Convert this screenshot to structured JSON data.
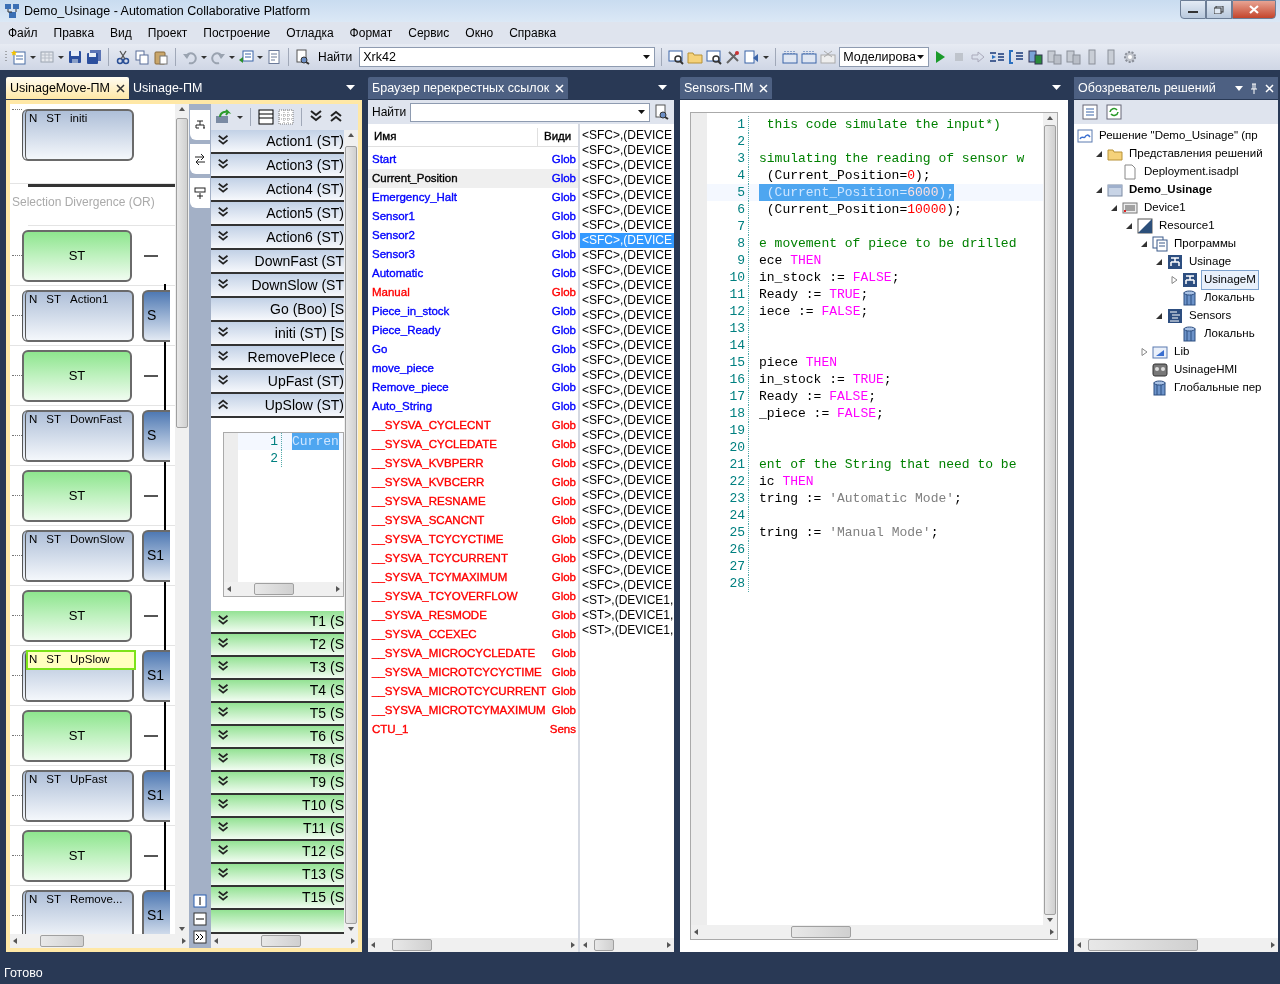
{
  "window": {
    "title": "Demo_Usinage - Automation Collaborative Platform"
  },
  "menu": [
    {
      "label": "Файл"
    },
    {
      "label": "Правка"
    },
    {
      "label": "Вид"
    },
    {
      "label": "Проект"
    },
    {
      "label": "Построение"
    },
    {
      "label": "Отладка"
    },
    {
      "label": "Формат"
    },
    {
      "label": "Сервис"
    },
    {
      "label": "Окно"
    },
    {
      "label": "Справка"
    }
  ],
  "toolbar": {
    "find_label": "Найти",
    "find_value": "Xrk42",
    "mode_value": "Моделирова"
  },
  "left_panel": {
    "tabs": [
      {
        "label": "UsinageMove-ПМ",
        "selected": true
      },
      {
        "label": "Usinage-ПМ",
        "selected": false
      }
    ],
    "sfc": [
      {
        "kind": "action",
        "qualifier": "N",
        "language": "ST",
        "name": "initi",
        "selected": false
      },
      {
        "kind": "divergence",
        "label": "Selection Divergence (OR)"
      },
      {
        "kind": "transition",
        "language": "ST"
      },
      {
        "kind": "action",
        "qualifier": "N",
        "language": "ST",
        "name": "Action1",
        "step": "S",
        "selected": false
      },
      {
        "kind": "transition",
        "language": "ST"
      },
      {
        "kind": "action",
        "qualifier": "N",
        "language": "ST",
        "name": "DownFast",
        "step": "S",
        "selected": false
      },
      {
        "kind": "transition",
        "language": "ST"
      },
      {
        "kind": "action",
        "qualifier": "N",
        "language": "ST",
        "name": "DownSlow",
        "step": "S1",
        "selected": false
      },
      {
        "kind": "transition",
        "language": "ST"
      },
      {
        "kind": "action",
        "qualifier": "N",
        "language": "ST",
        "name": "UpSlow",
        "step": "S1",
        "selected": true
      },
      {
        "kind": "transition",
        "language": "ST"
      },
      {
        "kind": "action",
        "qualifier": "N",
        "language": "ST",
        "name": "UpFast",
        "step": "S1",
        "selected": false
      },
      {
        "kind": "transition",
        "language": "ST"
      },
      {
        "kind": "action",
        "qualifier": "N",
        "language": "ST",
        "name": "Remove...",
        "step": "S1",
        "selected": false
      }
    ],
    "actions": [
      {
        "label": "Action1 (ST)",
        "kind": "code",
        "expanded": false
      },
      {
        "label": "Action3 (ST)",
        "kind": "code",
        "expanded": false
      },
      {
        "label": "Action4 (ST)",
        "kind": "code",
        "expanded": false
      },
      {
        "label": "Action5 (ST)",
        "kind": "code",
        "expanded": false
      },
      {
        "label": "Action6 (ST)",
        "kind": "code",
        "expanded": false
      },
      {
        "label": "DownFast (ST",
        "kind": "code",
        "expanded": false
      },
      {
        "label": "DownSlow (ST",
        "kind": "code",
        "expanded": false
      },
      {
        "label": "Go (Boo) [S",
        "kind": "boolean"
      },
      {
        "label": "initi (ST) [S",
        "kind": "code",
        "expanded": false
      },
      {
        "label": "RemovePIece (",
        "kind": "code",
        "expanded": false
      },
      {
        "label": "UpFast (ST)",
        "kind": "code",
        "expanded": false
      },
      {
        "label": "UpSlow (ST)",
        "kind": "code",
        "expanded": true
      }
    ],
    "action_code": [
      {
        "number": "1",
        "text": "Curren",
        "selected": true
      },
      {
        "number": "2"
      }
    ],
    "transitions": [
      {
        "label": "T1 (S"
      },
      {
        "label": "T2 (S"
      },
      {
        "label": "T3 (S"
      },
      {
        "label": "T4 (S"
      },
      {
        "label": "T5 (S"
      },
      {
        "label": "T6 (S"
      },
      {
        "label": "T8 (S"
      },
      {
        "label": "T9 (S"
      },
      {
        "label": "T10 (S"
      },
      {
        "label": "T11 (S"
      },
      {
        "label": "T12 (S"
      },
      {
        "label": "T13 (S"
      },
      {
        "label": "T15 (S"
      }
    ]
  },
  "xref": {
    "tab": "Браузер перекрестных ссылок",
    "find_label": "Найти",
    "columns": [
      "Имя",
      "Види"
    ],
    "rows": [
      {
        "name": "Start",
        "scope": "Glob",
        "color": "#0000ff",
        "selected": false
      },
      {
        "name": "Current_Position",
        "scope": "Glob",
        "color": "#0000ff",
        "selected": true
      },
      {
        "name": "Emergency_Halt",
        "scope": "Glob",
        "color": "#0000ff",
        "selected": false
      },
      {
        "name": "Sensor1",
        "scope": "Glob",
        "color": "#0000ff",
        "selected": false
      },
      {
        "name": "Sensor2",
        "scope": "Glob",
        "color": "#0000ff",
        "selected": false
      },
      {
        "name": "Sensor3",
        "scope": "Glob",
        "color": "#0000ff",
        "selected": false
      },
      {
        "name": "Automatic",
        "scope": "Glob",
        "color": "#0000ff",
        "selected": false
      },
      {
        "name": "Manual",
        "scope": "Glob",
        "color": "#ff0000",
        "selected": false
      },
      {
        "name": "Piece_in_stock",
        "scope": "Glob",
        "color": "#0000ff",
        "selected": false
      },
      {
        "name": "Piece_Ready",
        "scope": "Glob",
        "color": "#0000ff",
        "selected": false
      },
      {
        "name": "Go",
        "scope": "Glob",
        "color": "#0000ff",
        "selected": false
      },
      {
        "name": "move_piece",
        "scope": "Glob",
        "color": "#0000ff",
        "selected": false
      },
      {
        "name": "Remove_piece",
        "scope": "Glob",
        "color": "#0000ff",
        "selected": false
      },
      {
        "name": "Auto_String",
        "scope": "Glob",
        "color": "#0000ff",
        "selected": false
      },
      {
        "name": "__SYSVA_CYCLECNT",
        "scope": "Glob",
        "color": "#ff0000",
        "selected": false
      },
      {
        "name": "__SYSVA_CYCLEDATE",
        "scope": "Glob",
        "color": "#ff0000",
        "selected": false
      },
      {
        "name": "__SYSVA_KVBPERR",
        "scope": "Glob",
        "color": "#ff0000",
        "selected": false
      },
      {
        "name": "__SYSVA_KVBCERR",
        "scope": "Glob",
        "color": "#ff0000",
        "selected": false
      },
      {
        "name": "__SYSVA_RESNAME",
        "scope": "Glob",
        "color": "#ff0000",
        "selected": false
      },
      {
        "name": "__SYSVA_SCANCNT",
        "scope": "Glob",
        "color": "#ff0000",
        "selected": false
      },
      {
        "name": "__SYSVA_TCYCYCTIME",
        "scope": "Glob",
        "color": "#ff0000",
        "selected": false
      },
      {
        "name": "__SYSVA_TCYCURRENT",
        "scope": "Glob",
        "color": "#ff0000",
        "selected": false
      },
      {
        "name": "__SYSVA_TCYMAXIMUM",
        "scope": "Glob",
        "color": "#ff0000",
        "selected": false
      },
      {
        "name": "__SYSVA_TCYOVERFLOW",
        "scope": "Glob",
        "color": "#ff0000",
        "selected": false
      },
      {
        "name": "__SYSVA_RESMODE",
        "scope": "Glob",
        "color": "#ff0000",
        "selected": false
      },
      {
        "name": "__SYSVA_CCEXEC",
        "scope": "Glob",
        "color": "#ff0000",
        "selected": false
      },
      {
        "name": "__SYSVA_MICROCYCLEDATE",
        "scope": "Glob",
        "color": "#ff0000",
        "selected": false
      },
      {
        "name": "__SYSVA_MICROTCYCYCTIME",
        "scope": "Glob",
        "color": "#ff0000",
        "selected": false
      },
      {
        "name": "__SYSVA_MICROTCYCURRENT",
        "scope": "Glob",
        "color": "#ff0000",
        "selected": false
      },
      {
        "name": "__SYSVA_MICROTCYMAXIMUM",
        "scope": "Glob",
        "color": "#ff0000",
        "selected": false
      },
      {
        "name": "CTU_1",
        "scope": "Sens",
        "color": "#ff0000",
        "selected": false
      }
    ],
    "references": [
      {
        "text": "<SFC>,(DEVICE",
        "selected": false
      },
      {
        "text": "<SFC>,(DEVICE",
        "selected": false
      },
      {
        "text": "<SFC>,(DEVICE",
        "selected": false
      },
      {
        "text": "<SFC>,(DEVICE",
        "selected": false
      },
      {
        "text": "<SFC>,(DEVICE",
        "selected": false
      },
      {
        "text": "<SFC>,(DEVICE",
        "selected": false
      },
      {
        "text": "<SFC>,(DEVICE",
        "selected": false
      },
      {
        "text": "<SFC>,(DEVICE",
        "selected": true
      },
      {
        "text": "<SFC>,(DEVICE",
        "selected": false
      },
      {
        "text": "<SFC>,(DEVICE",
        "selected": false
      },
      {
        "text": "<SFC>,(DEVICE",
        "selected": false
      },
      {
        "text": "<SFC>,(DEVICE",
        "selected": false
      },
      {
        "text": "<SFC>,(DEVICE",
        "selected": false
      },
      {
        "text": "<SFC>,(DEVICE",
        "selected": false
      },
      {
        "text": "<SFC>,(DEVICE",
        "selected": false
      },
      {
        "text": "<SFC>,(DEVICE",
        "selected": false
      },
      {
        "text": "<SFC>,(DEVICE",
        "selected": false
      },
      {
        "text": "<SFC>,(DEVICE",
        "selected": false
      },
      {
        "text": "<SFC>,(DEVICE",
        "selected": false
      },
      {
        "text": "<SFC>,(DEVICE",
        "selected": false
      },
      {
        "text": "<SFC>,(DEVICE",
        "selected": false
      },
      {
        "text": "<SFC>,(DEVICE",
        "selected": false
      },
      {
        "text": "<SFC>,(DEVICE",
        "selected": false
      },
      {
        "text": "<SFC>,(DEVICE",
        "selected": false
      },
      {
        "text": "<SFC>,(DEVICE",
        "selected": false
      },
      {
        "text": "<SFC>,(DEVICE",
        "selected": false
      },
      {
        "text": "<SFC>,(DEVICE",
        "selected": false
      },
      {
        "text": "<SFC>,(DEVICE",
        "selected": false
      },
      {
        "text": "<SFC>,(DEVICE",
        "selected": false
      },
      {
        "text": "<SFC>,(DEVICE",
        "selected": false
      },
      {
        "text": "<SFC>,(DEVICE",
        "selected": false
      },
      {
        "text": "<ST>,(DEVICE1,",
        "selected": false
      },
      {
        "text": "<ST>,(DEVICE1,",
        "selected": false
      },
      {
        "text": "<ST>,(DEVICE1,",
        "selected": false
      }
    ]
  },
  "code_panel": {
    "tab": "Sensors-ПМ",
    "lines": [
      {
        "number": "1",
        "selected": false,
        "segments": [
          {
            "kind": "comment",
            "text": " this code simulate the input*)"
          }
        ]
      },
      {
        "number": "2"
      },
      {
        "number": "3",
        "selected": false,
        "segments": [
          {
            "kind": "comment",
            "text": "simulating the reading of sensor w"
          }
        ]
      },
      {
        "number": "4",
        "selected": false,
        "segments": [
          {
            "kind": "code",
            "text": " (Current_Position="
          },
          {
            "kind": "number",
            "text": "0"
          },
          {
            "kind": "code",
            "text": ");"
          }
        ]
      },
      {
        "number": "5",
        "selected": true,
        "segments": [
          {
            "kind": "code",
            "text": " (Current_Position="
          },
          {
            "kind": "number",
            "text": "6000"
          },
          {
            "kind": "code",
            "text": ");"
          }
        ]
      },
      {
        "number": "6",
        "selected": false,
        "segments": [
          {
            "kind": "code",
            "text": " (Current_Position="
          },
          {
            "kind": "number",
            "text": "10000"
          },
          {
            "kind": "code",
            "text": ");"
          }
        ]
      },
      {
        "number": "7"
      },
      {
        "number": "8",
        "selected": false,
        "segments": [
          {
            "kind": "comment",
            "text": "e movement of piece to be drilled"
          }
        ]
      },
      {
        "number": "9",
        "selected": false,
        "segments": [
          {
            "kind": "code",
            "text": "ece "
          },
          {
            "kind": "keyword",
            "text": "THEN"
          }
        ]
      },
      {
        "number": "10",
        "selected": false,
        "segments": [
          {
            "kind": "code",
            "text": "in_stock := "
          },
          {
            "kind": "keyword",
            "text": "FALSE"
          },
          {
            "kind": "code",
            "text": ";"
          }
        ]
      },
      {
        "number": "11",
        "selected": false,
        "segments": [
          {
            "kind": "code",
            "text": "Ready := "
          },
          {
            "kind": "keyword",
            "text": "TRUE"
          },
          {
            "kind": "code",
            "text": ";"
          }
        ]
      },
      {
        "number": "12",
        "selected": false,
        "segments": [
          {
            "kind": "code",
            "text": "iece := "
          },
          {
            "kind": "keyword",
            "text": "FALSE"
          },
          {
            "kind": "code",
            "text": ";"
          }
        ]
      },
      {
        "number": "13"
      },
      {
        "number": "14"
      },
      {
        "number": "15",
        "selected": false,
        "segments": [
          {
            "kind": "code",
            "text": "piece "
          },
          {
            "kind": "keyword",
            "text": "THEN"
          }
        ]
      },
      {
        "number": "16",
        "selected": false,
        "segments": [
          {
            "kind": "code",
            "text": "in_stock := "
          },
          {
            "kind": "keyword",
            "text": "TRUE"
          },
          {
            "kind": "code",
            "text": ";"
          }
        ]
      },
      {
        "number": "17",
        "selected": false,
        "segments": [
          {
            "kind": "code",
            "text": "Ready := "
          },
          {
            "kind": "keyword",
            "text": "FALSE"
          },
          {
            "kind": "code",
            "text": ";"
          }
        ]
      },
      {
        "number": "18",
        "selected": false,
        "segments": [
          {
            "kind": "code",
            "text": "_piece := "
          },
          {
            "kind": "keyword",
            "text": "FALSE"
          },
          {
            "kind": "code",
            "text": ";"
          }
        ]
      },
      {
        "number": "19"
      },
      {
        "number": "20"
      },
      {
        "number": "21",
        "selected": false,
        "segments": [
          {
            "kind": "comment",
            "text": "ent of the String that need to be"
          }
        ]
      },
      {
        "number": "22",
        "selected": false,
        "segments": [
          {
            "kind": "code",
            "text": "ic "
          },
          {
            "kind": "keyword",
            "text": "THEN"
          }
        ]
      },
      {
        "number": "23",
        "selected": false,
        "segments": [
          {
            "kind": "code",
            "text": "tring := "
          },
          {
            "kind": "string",
            "text": "'Automatic Mode'"
          },
          {
            "kind": "code",
            "text": ";"
          }
        ]
      },
      {
        "number": "24"
      },
      {
        "number": "25",
        "selected": false,
        "segments": [
          {
            "kind": "code",
            "text": "tring := "
          },
          {
            "kind": "string",
            "text": "'Manual Mode'"
          },
          {
            "kind": "code",
            "text": ";"
          }
        ]
      },
      {
        "number": "26"
      },
      {
        "number": "27"
      },
      {
        "number": "28"
      }
    ]
  },
  "solution": {
    "title": "Обозреватель решений",
    "tree": [
      {
        "label": "Решение \"Demo_Usinage\"  (пр",
        "kind": "solution",
        "selected": false,
        "children": [
          {
            "label": "Представления решений",
            "kind": "folder",
            "selected": false,
            "expanded": true,
            "children": [
              {
                "label": "Deployment.isadpl",
                "kind": "file",
                "selected": false
              }
            ]
          },
          {
            "label": "Demo_Usinage",
            "kind": "project",
            "selected": false,
            "expanded": true,
            "children": [
              {
                "label": "Device1",
                "kind": "device",
                "selected": false,
                "expanded": true,
                "children": [
                  {
                    "label": "Resource1",
                    "kind": "resource",
                    "selected": false,
                    "expanded": true,
                    "children": [
                      {
                        "label": "Программы",
                        "kind": "programs",
                        "selected": false,
                        "expanded": true,
                        "children": [
                          {
                            "label": "Usinage",
                            "kind": "sfc",
                            "selected": false,
                            "expanded": true,
                            "children": [
                              {
                                "label": "UsinageM",
                                "kind": "sfc",
                                "selected": true,
                                "expanded": false
                              },
                              {
                                "label": "Локальнь",
                                "kind": "variables",
                                "selected": false
                              }
                            ]
                          },
                          {
                            "label": "Sensors",
                            "kind": "st",
                            "selected": false,
                            "expanded": true,
                            "children": [
                              {
                                "label": "Локальнь",
                                "kind": "variables",
                                "selected": false
                              }
                            ]
                          }
                        ]
                      },
                      {
                        "label": "Lib",
                        "kind": "library",
                        "selected": false,
                        "expanded": false
                      },
                      {
                        "label": "UsinageHMI",
                        "kind": "hmi",
                        "selected": false
                      },
                      {
                        "label": "Глобальные пер",
                        "kind": "variables",
                        "selected": false
                      }
                    ]
                  }
                ]
              }
            ]
          }
        ]
      }
    ]
  },
  "status_bar": {
    "text": "Готово"
  }
}
